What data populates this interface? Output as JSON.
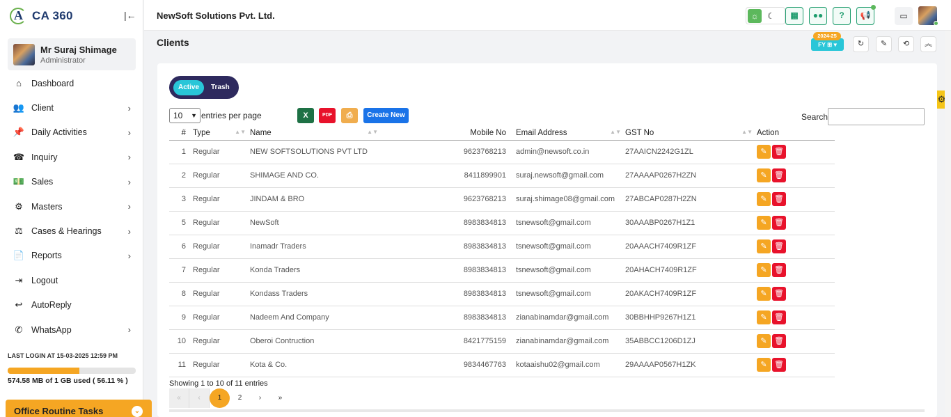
{
  "brand": {
    "name": "CA 360"
  },
  "user": {
    "name": "Mr Suraj Shimage",
    "role": "Administrator"
  },
  "menu": [
    {
      "label": "Dashboard",
      "icon": "home-icon",
      "glyph": "⌂",
      "has_sub": false
    },
    {
      "label": "Client",
      "icon": "users-icon",
      "glyph": "👥",
      "has_sub": true
    },
    {
      "label": "Daily Activities",
      "icon": "pin-icon",
      "glyph": "📌",
      "has_sub": true
    },
    {
      "label": "Inquiry",
      "icon": "phone-icon",
      "glyph": "☎",
      "has_sub": true
    },
    {
      "label": "Sales",
      "icon": "money-icon",
      "glyph": "💵",
      "has_sub": true
    },
    {
      "label": "Masters",
      "icon": "gears-icon",
      "glyph": "⚙",
      "has_sub": true
    },
    {
      "label": "Cases & Hearings",
      "icon": "scale-icon",
      "glyph": "⚖",
      "has_sub": true
    },
    {
      "label": "Reports",
      "icon": "file-icon",
      "glyph": "📄",
      "has_sub": true
    },
    {
      "label": "Logout",
      "icon": "logout-icon",
      "glyph": "⇥",
      "has_sub": false
    },
    {
      "label": "AutoReply",
      "icon": "reply-icon",
      "glyph": "↩",
      "has_sub": false
    },
    {
      "label": "WhatsApp",
      "icon": "whatsapp-icon",
      "glyph": "✆",
      "has_sub": true
    }
  ],
  "last_login": "LAST LOGIN AT 15-03-2025 12:59 PM",
  "storage": {
    "text": "574.58 MB of 1 GB used ( 56.11 % )",
    "percent": 56.11
  },
  "routine_label": "Office Routine Tasks",
  "header": {
    "company": "NewSoft Solutions Pvt. Ltd."
  },
  "page": {
    "title": "Clients",
    "fy_year": "2024-25",
    "fy_label": "FY ⊞ ▾"
  },
  "tabs": {
    "active": "Active",
    "trash": "Trash"
  },
  "controls": {
    "length_value": "10",
    "length_label": "entries per page",
    "excel": "X",
    "pdf": "PDF",
    "print": "⎙",
    "create_new": "Create New",
    "search_label": "Search:",
    "search_value": ""
  },
  "table": {
    "headers": {
      "num": "#",
      "type": "Type",
      "name": "Name",
      "mobile": "Mobile No",
      "email": "Email Address",
      "gst": "GST No",
      "action": "Action"
    },
    "rows": [
      {
        "num": "1",
        "type": "Regular",
        "name": "NEW SOFTSOLUTIONS PVT LTD",
        "mobile": "9623768213",
        "email": "admin@newsoft.co.in",
        "gst": "27AAICN2242G1ZL"
      },
      {
        "num": "2",
        "type": "Regular",
        "name": "SHIMAGE AND CO.",
        "mobile": "8411899901",
        "email": "suraj.newsoft@gmail.com",
        "gst": "27AAAAP0267H2ZN"
      },
      {
        "num": "3",
        "type": "Regular",
        "name": "JINDAM & BRO",
        "mobile": "9623768213",
        "email": "suraj.shimage08@gmail.com",
        "gst": "27ABCAP0287H2ZN"
      },
      {
        "num": "5",
        "type": "Regular",
        "name": "NewSoft",
        "mobile": "8983834813",
        "email": "tsnewsoft@gmail.com",
        "gst": "30AAABP0267H1Z1"
      },
      {
        "num": "6",
        "type": "Regular",
        "name": "Inamadr Traders",
        "mobile": "8983834813",
        "email": "tsnewsoft@gmail.com",
        "gst": "20AAACH7409R1ZF"
      },
      {
        "num": "7",
        "type": "Regular",
        "name": "Konda Traders",
        "mobile": "8983834813",
        "email": "tsnewsoft@gmail.com",
        "gst": "20AHACH7409R1ZF"
      },
      {
        "num": "8",
        "type": "Regular",
        "name": "Kondass Traders",
        "mobile": "8983834813",
        "email": "tsnewsoft@gmail.com",
        "gst": "20AKACH7409R1ZF"
      },
      {
        "num": "9",
        "type": "Regular",
        "name": "Nadeem And Company",
        "mobile": "8983834813",
        "email": "zianabinamdar@gmail.com",
        "gst": "30BBHHP9267H1Z1"
      },
      {
        "num": "10",
        "type": "Regular",
        "name": "Oberoi Contruction",
        "mobile": "8421775159",
        "email": "zianabinamdar@gmail.com",
        "gst": "35ABBCC1206D1ZJ"
      },
      {
        "num": "11",
        "type": "Regular",
        "name": "Kota & Co.",
        "mobile": "9834467763",
        "email": "kotaaishu02@gmail.com",
        "gst": "29AAAAP0567H1ZK"
      }
    ]
  },
  "footer": {
    "showing": "Showing 1 to 10 of 11 entries",
    "pages": [
      "«",
      "‹",
      "1",
      "2",
      "›",
      "»"
    ],
    "current_page": "1"
  },
  "colors": {
    "accent": "#f5a623",
    "primary": "#1a73e8",
    "teal": "#29c6d8",
    "navy": "#2e2a5e",
    "danger": "#e8122b",
    "green": "#1f9d6e"
  }
}
